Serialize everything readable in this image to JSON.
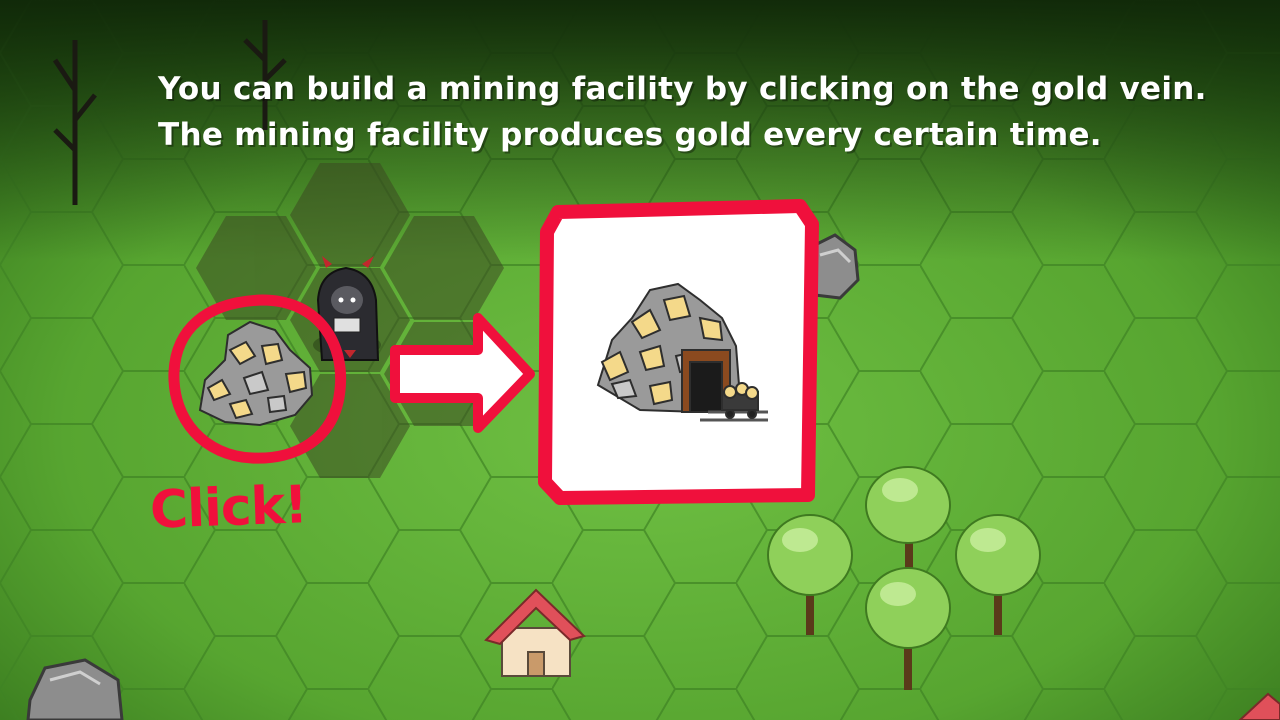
{
  "tutorial": {
    "line1": "You can build a mining facility by clicking on the gold vein.",
    "line2": "The mining facility produces gold every certain time.",
    "click_label": "Click!"
  },
  "colors": {
    "grass": "#5aa832",
    "accent": "#f0103c",
    "gold": "#f4d98a",
    "rock": "#9a9a9a"
  },
  "icons": {
    "gold_vein": "gold-vein-icon",
    "mine": "gold-mine-icon",
    "character": "demon-character-icon",
    "arrow": "right-arrow-icon",
    "house": "house-icon",
    "tree": "tree-icon",
    "boulder": "boulder-icon"
  }
}
